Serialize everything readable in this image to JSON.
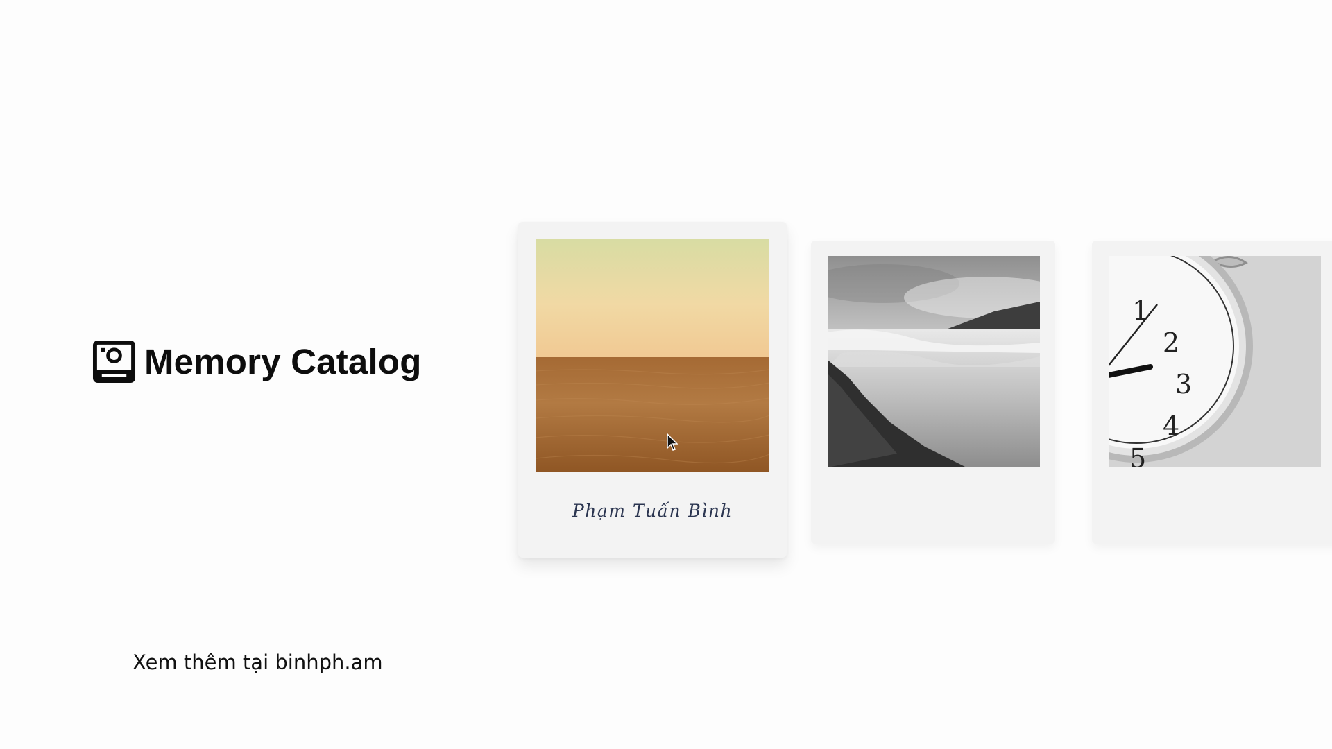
{
  "brand": {
    "title": "Memory Catalog",
    "icon": "polaroid-camera-icon"
  },
  "cards": [
    {
      "caption": "Phạm Tuấn Bình",
      "photo": "desert-horizon",
      "active": true
    },
    {
      "caption": "",
      "photo": "waterfall-bw"
    },
    {
      "caption": "",
      "photo": "alarm-clock",
      "clock_numerals": [
        "1",
        "2",
        "3",
        "4",
        "5"
      ]
    }
  ],
  "footer": {
    "prefix": "Xem thêm tại",
    "url": "binhph.am"
  },
  "colors": {
    "background": "#fdfdfd",
    "card": "#f3f3f3",
    "caption": "#2b3550",
    "text": "#0d0d0d"
  }
}
